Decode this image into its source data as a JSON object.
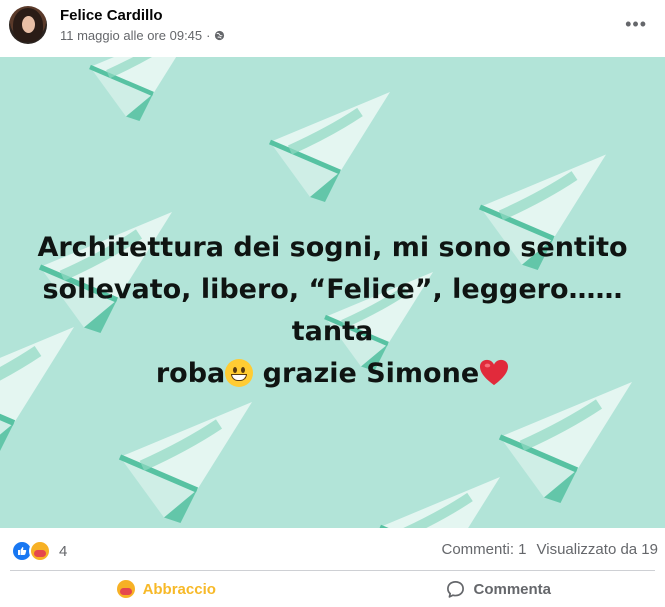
{
  "post": {
    "author": "Felice Cardillo",
    "date": "11 maggio alle ore 09:45",
    "separator": "·",
    "audience_icon": "globe-icon",
    "more_icon": "ellipsis-icon",
    "text_line1": "Architettura dei sogni, mi sono sentito",
    "text_line2": "sollevato, libero, “Felice”, leggero……tanta",
    "text_line3_part1": "roba",
    "text_line3_part2": " grazie Simone",
    "background_color": "#b2e4d8"
  },
  "stats": {
    "reaction_icons": [
      "like-icon",
      "care-icon"
    ],
    "reaction_count": "4",
    "comments": "Commenti: 1",
    "views": "Visualizzato da 19"
  },
  "actions": {
    "care_label": "Abbraccio",
    "comment_label": "Commenta",
    "care_color": "#f7b928"
  }
}
